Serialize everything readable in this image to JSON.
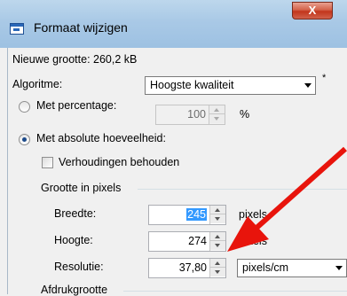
{
  "window": {
    "title": "Formaat wijzigen",
    "close_glyph": "X",
    "title_icon": "resize-window-icon"
  },
  "info": {
    "new_size": "Nieuwe grootte: 260,2 kB"
  },
  "algorithm": {
    "label": "Algoritme:",
    "value": "Hoogste kwaliteit",
    "required_mark": "*"
  },
  "percentage": {
    "label": "Met percentage:",
    "value": "100",
    "unit": "%",
    "checked": false,
    "enabled": false
  },
  "absolute": {
    "label": "Met absolute hoeveelheid:",
    "checked": true
  },
  "keep_ratio": {
    "label": "Verhoudingen behouden",
    "checked": false
  },
  "pixel_group": {
    "title": "Grootte in pixels",
    "width_label": "Breedte:",
    "width_value": "245",
    "width_unit": "pixels",
    "height_label": "Hoogte:",
    "height_value": "274",
    "height_unit": "pixels",
    "resolution_label": "Resolutie:",
    "resolution_value": "37,80",
    "resolution_unit": "pixels/cm"
  },
  "print_group": {
    "title": "Afdrukgrootte"
  },
  "annotation": {
    "color": "#e8140c"
  }
}
